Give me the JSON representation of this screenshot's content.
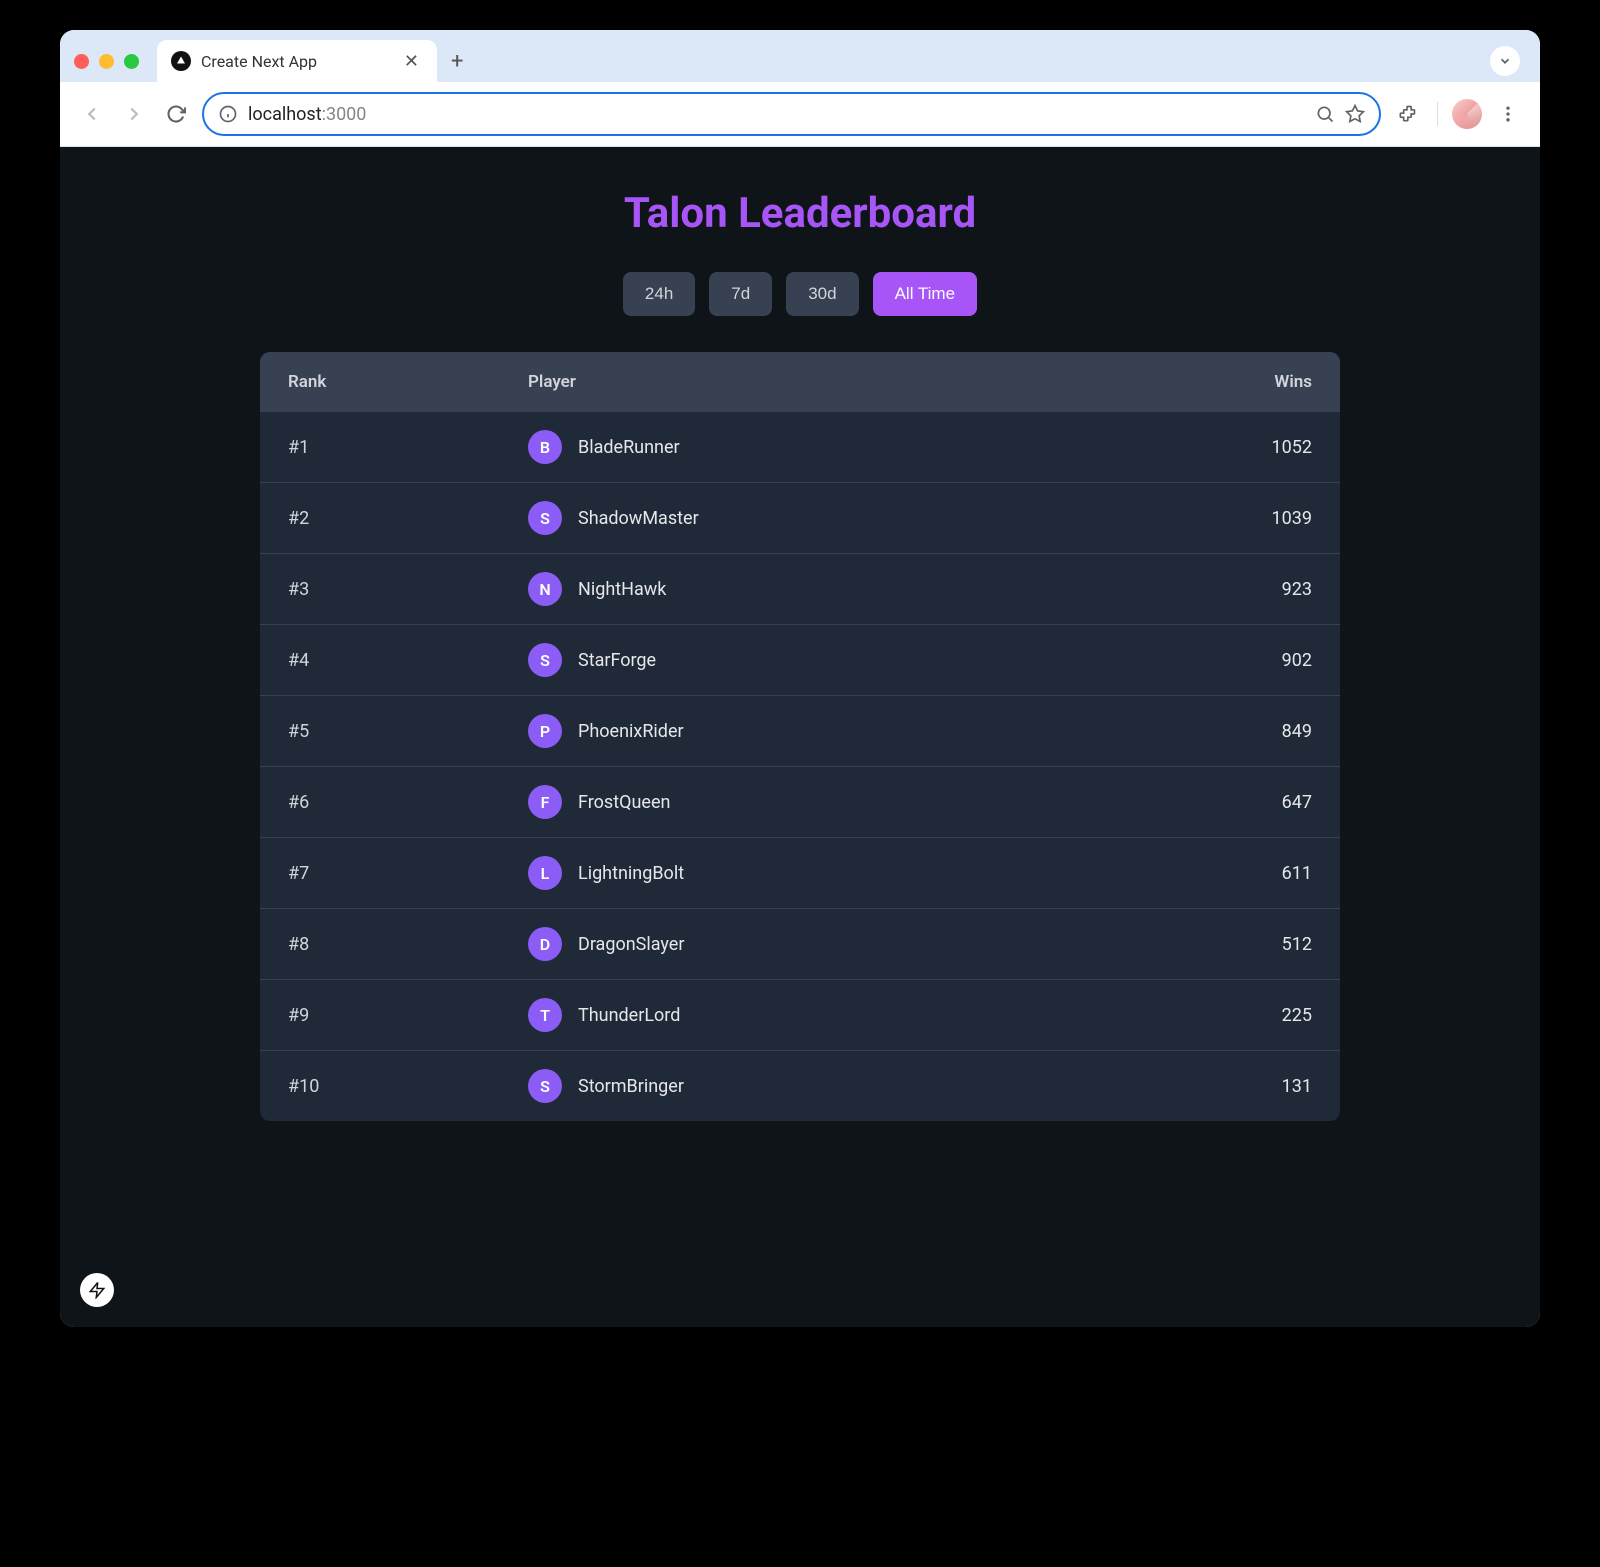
{
  "browser": {
    "tab_title": "Create Next App",
    "address_host": "localhost",
    "address_path": ":3000"
  },
  "page": {
    "title": "Talon Leaderboard",
    "filters": [
      {
        "label": "24h",
        "active": false
      },
      {
        "label": "7d",
        "active": false
      },
      {
        "label": "30d",
        "active": false
      },
      {
        "label": "All Time",
        "active": true
      }
    ],
    "columns": {
      "rank": "Rank",
      "player": "Player",
      "wins": "Wins"
    },
    "rows": [
      {
        "rank": "#1",
        "initial": "B",
        "name": "BladeRunner",
        "wins": "1052"
      },
      {
        "rank": "#2",
        "initial": "S",
        "name": "ShadowMaster",
        "wins": "1039"
      },
      {
        "rank": "#3",
        "initial": "N",
        "name": "NightHawk",
        "wins": "923"
      },
      {
        "rank": "#4",
        "initial": "S",
        "name": "StarForge",
        "wins": "902"
      },
      {
        "rank": "#5",
        "initial": "P",
        "name": "PhoenixRider",
        "wins": "849"
      },
      {
        "rank": "#6",
        "initial": "F",
        "name": "FrostQueen",
        "wins": "647"
      },
      {
        "rank": "#7",
        "initial": "L",
        "name": "LightningBolt",
        "wins": "611"
      },
      {
        "rank": "#8",
        "initial": "D",
        "name": "DragonSlayer",
        "wins": "512"
      },
      {
        "rank": "#9",
        "initial": "T",
        "name": "ThunderLord",
        "wins": "225"
      },
      {
        "rank": "#10",
        "initial": "S",
        "name": "StormBringer",
        "wins": "131"
      }
    ]
  },
  "colors": {
    "accent": "#a855f7",
    "bg": "#0f1419",
    "card": "#1f2937",
    "header": "#374151"
  }
}
